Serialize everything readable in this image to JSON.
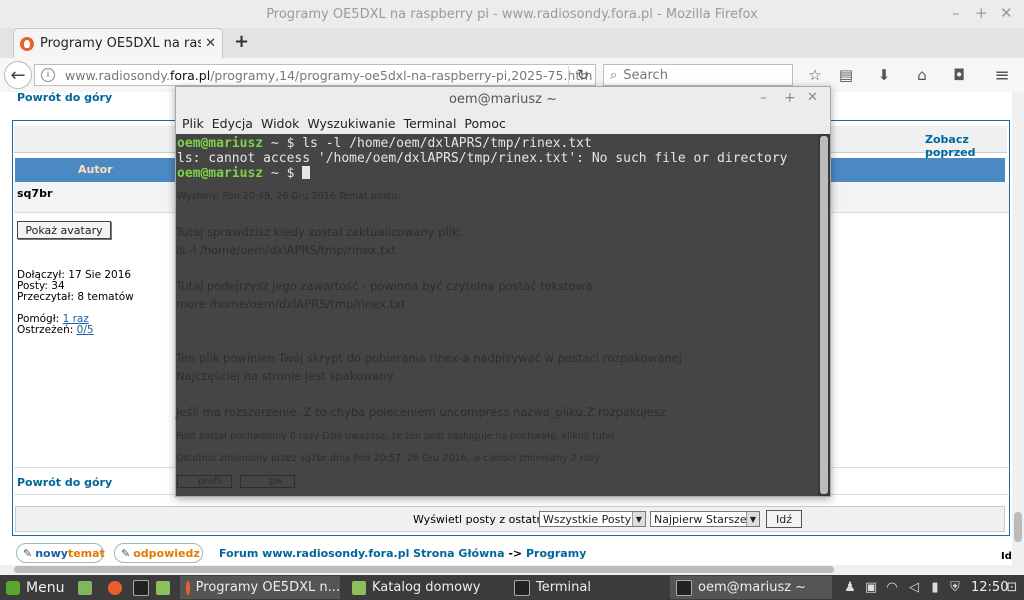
{
  "browser": {
    "window_title": "Programy OE5DXL na raspberry pi - www.radiosondy.fora.pl - Mozilla Firefox",
    "tab_title": "Programy OE5DXL na ras…",
    "new_tab": "+",
    "url_prefix": "www.radiosondy.",
    "url_host": "fora.pl",
    "url_path": "/programy,14/programy-oe5dxl-na-raspberry-pi,2025-75.htm",
    "search_placeholder": "Search",
    "win_min": "–",
    "win_max": "+",
    "win_close": "✕"
  },
  "page": {
    "top_link": "Powrót do góry",
    "zobacz": "Zobacz poprzed",
    "author_header": "Autor",
    "poster": "sq7br",
    "avatar_button": "Pokaż avatary",
    "joined": "Dołączył: 17 Sie 2016",
    "posts": "Posty: 34",
    "read": "Przeczytał: 8 tematów",
    "helped_label": "Pomógł: ",
    "helped_link": "1 raz",
    "warnings_label": "Ostrzeżeń: ",
    "warnings_link": "0/5",
    "bottom_link": "Powrót do góry",
    "show_posts_label": "Wyświetl posty z ostatnich:",
    "select_posts": "Wszystkie Posty",
    "select_order": "Najpierw Starsze",
    "go_button": "Idź",
    "btn_new_topic_a": "nowy",
    "btn_new_topic_b": "temat",
    "btn_reply": "odpowiedz",
    "breadcrumb_forum": "Forum www.radiosondy.fora.pl Strona Główna",
    "breadcrumb_sep": " -> ",
    "breadcrumb_section": "Programy",
    "edge_text": "Id"
  },
  "ghost": {
    "meta": "Wysłany: Pon 20:49, 26 Gru 2016    Temat postu:",
    "l1": "Tutaj sprawdzisz kiedy został zaktualizowany plik:",
    "l2": "ls -l /home/oem/dxlAPRS/tmp/rinex.txt",
    "l3": "Tutaj podejrzysz jego zawartość - powinna być czytelna postać tekstowa",
    "l4": "more /home/oem/dxlAPRS/tmp/rinex.txt",
    "l5": "Ten plik powinien Twój skrypt do pobierania rinex-a nadpisywać w postaci rozpakowanej",
    "l6": "Najczęściej na stronie jest spakowany.",
    "l7": "Jeśli ma rozszerzenie .Z to chyba poleceniem uncompress nazwa_pliku.Z rozpakujesz",
    "l8": "Post został pochwalony 0 razy Dziś uważasz, że ten post zasługuje na pochwałę, kliknij",
    "l8b": "tutaj",
    "l9": "Ostatnio zmieniony przez sq7br dnia Pon 20:57, 26 Gru 2016, w całości zmieniany 2 razy",
    "b1": "profil",
    "b2": "pw"
  },
  "terminal": {
    "title": "oem@mariusz ~",
    "menu": [
      "Plik",
      "Edycja",
      "Widok",
      "Wyszukiwanie",
      "Terminal",
      "Pomoc"
    ],
    "prompt1": "oem@mariusz",
    "prompt_sep": " ~ $ ",
    "cmd1": "ls -l /home/oem/dxlAPRS/tmp/rinex.txt",
    "out1": "ls: cannot access '/home/oem/dxlAPRS/tmp/rinex.txt': No such file or directory",
    "prompt2": "oem@mariusz",
    "prompt_sep2": " ~ $ ",
    "win_min": "–",
    "win_max": "+",
    "win_close": "✕"
  },
  "taskbar": {
    "menu": "Menu",
    "items": [
      "Programy OE5DXL n...",
      "Katalog domowy",
      "Terminal",
      "oem@mariusz ~"
    ],
    "clock": "12:50"
  }
}
